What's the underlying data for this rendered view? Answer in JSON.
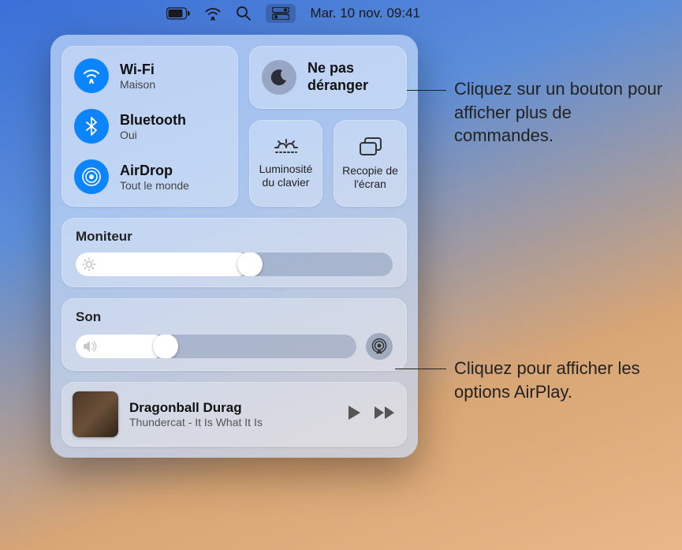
{
  "menubar": {
    "datetime": "Mar. 10 nov.  09:41"
  },
  "connectivity": {
    "wifi": {
      "title": "Wi-Fi",
      "sub": "Maison"
    },
    "bluetooth": {
      "title": "Bluetooth",
      "sub": "Oui"
    },
    "airdrop": {
      "title": "AirDrop",
      "sub": "Tout le monde"
    }
  },
  "dnd": {
    "title": "Ne pas déranger"
  },
  "keyboard": {
    "label": "Luminosité du clavier"
  },
  "mirror": {
    "label": "Recopie de l'écran"
  },
  "display": {
    "label": "Moniteur",
    "value": 55
  },
  "sound": {
    "label": "Son",
    "value": 32
  },
  "media": {
    "song": "Dragonball Durag",
    "artist": "Thundercat - It Is What It Is"
  },
  "callouts": {
    "top": "Cliquez sur un bouton pour afficher plus de commandes.",
    "bottom": "Cliquez pour afficher les options AirPlay."
  }
}
